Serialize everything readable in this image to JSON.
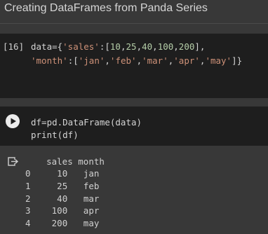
{
  "heading": {
    "title": "Creating DataFrames from Panda Series"
  },
  "cell1": {
    "prompt": "[16]",
    "line1": {
      "pre": "data={",
      "key1": "'sales'",
      "mid1": ":[",
      "nums": [
        "10",
        "25",
        "40",
        "100",
        "200"
      ],
      "end1": "],"
    },
    "line2": {
      "key2": "'month'",
      "mid2": ":[",
      "months": [
        "'jan'",
        "'feb'",
        "'mar'",
        "'apr'",
        "'may'"
      ],
      "end2": "]}"
    }
  },
  "cell2": {
    "line1": "df=pd.DataFrame(data)",
    "line2": "print(df)",
    "run_icon": "play-icon"
  },
  "output": {
    "icon": "output-redirect-icon",
    "table": {
      "columns": [
        "sales",
        "month"
      ],
      "rows": [
        {
          "index": "0",
          "sales": "10",
          "month": "jan"
        },
        {
          "index": "1",
          "sales": "25",
          "month": "feb"
        },
        {
          "index": "2",
          "sales": "40",
          "month": "mar"
        },
        {
          "index": "3",
          "sales": "100",
          "month": "apr"
        },
        {
          "index": "4",
          "sales": "200",
          "month": "may"
        }
      ]
    }
  }
}
